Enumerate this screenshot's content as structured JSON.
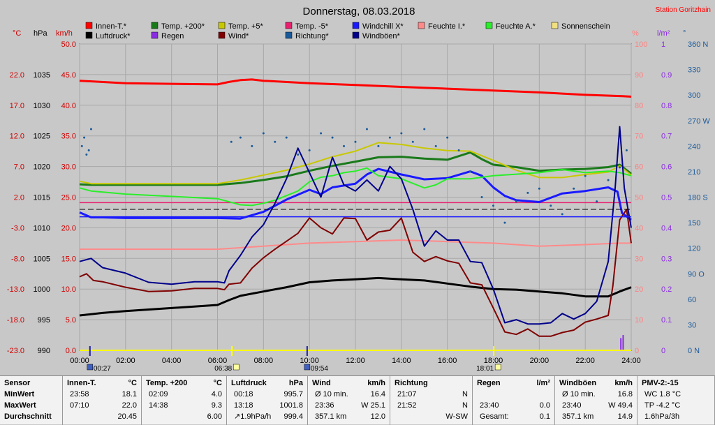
{
  "header": {
    "title": "Donnerstag, 08.03.2018",
    "station": "Station Goritzhain"
  },
  "colors": {
    "background": "#c8c8c8",
    "plot_area": "#c8c8c8",
    "grid": "#a8a8a8"
  },
  "legend": [
    {
      "label": "Innen-T.*",
      "color": "#ff0000"
    },
    {
      "label": "Temp. +200*",
      "color": "#1a7a1a"
    },
    {
      "label": "Temp. +5*",
      "color": "#c8c800"
    },
    {
      "label": "Temp. -5*",
      "color": "#e8206e"
    },
    {
      "label": "Windchill X*",
      "color": "#1a1aff"
    },
    {
      "label": "Feuchte I.*",
      "color": "#ff8a8a"
    },
    {
      "label": "Feuchte A.*",
      "color": "#2aee2a"
    },
    {
      "label": "Sonnenschein",
      "color": "#f0e080"
    },
    {
      "label": "Luftdruck*",
      "color": "#000000"
    },
    {
      "label": "Regen",
      "color": "#8a2be2"
    },
    {
      "label": "Wind*",
      "color": "#800000"
    },
    {
      "label": "Richtung*",
      "color": "#1a5a9a"
    },
    {
      "label": "Windböen*",
      "color": "#00008b"
    }
  ],
  "axes": {
    "left_units": [
      "°C",
      "hPa",
      "km/h"
    ],
    "right_units": [
      "%",
      "l/m²",
      "°"
    ],
    "celsius_ticks": [
      "22.0",
      "17.0",
      "12.0",
      "7.0",
      "2.0",
      "-3.0",
      "-8.0",
      "-13.0",
      "-18.0",
      "-23.0"
    ],
    "hpa_ticks": [
      "1035",
      "1030",
      "1025",
      "1020",
      "1015",
      "1010",
      "1005",
      "1000",
      "995",
      "990"
    ],
    "kmh_ticks": [
      "50.0",
      "45.0",
      "40.0",
      "35.0",
      "30.0",
      "25.0",
      "20.0",
      "15.0",
      "10.0",
      "5.0",
      "0.0"
    ],
    "pct_ticks": [
      "100",
      "90",
      "80",
      "70",
      "60",
      "50",
      "40",
      "30",
      "20",
      "10",
      "0"
    ],
    "rain_ticks": [
      "1",
      "0.9",
      "0.8",
      "0.7",
      "0.6",
      "0.5",
      "0.4",
      "0.3",
      "0.2",
      "0.1",
      "0"
    ],
    "dir_ticks": [
      "360 N",
      "330",
      "300",
      "270 W",
      "240",
      "210",
      "180 S",
      "150",
      "120",
      "90 O",
      "60",
      "30",
      "0  N"
    ],
    "time_ticks": [
      "00:00",
      "02:00",
      "04:00",
      "06:00",
      "08:00",
      "10:00",
      "12:00",
      "14:00",
      "16:00",
      "18:00",
      "20:00",
      "22:00",
      "24:00"
    ],
    "sun_events": [
      {
        "label": "00:27",
        "type": "moonrise"
      },
      {
        "label": "06:38",
        "type": "sunrise"
      },
      {
        "label": "09:54",
        "type": "moonset"
      },
      {
        "label": "18:01",
        "type": "sunset"
      }
    ]
  },
  "chart_data": {
    "type": "line",
    "x_unit": "hour",
    "x_range": [
      0,
      24
    ],
    "y_ranges": {
      "temp_c": [
        -23,
        27
      ],
      "pressure_hpa": [
        990,
        1040
      ],
      "wind_kmh": [
        0,
        50
      ],
      "humidity_pct": [
        0,
        100
      ],
      "rain_lm2": [
        0,
        1
      ],
      "direction_deg": [
        0,
        360
      ]
    },
    "grid": true,
    "series": [
      {
        "name": "Innen-T.*",
        "axis": "temp_c",
        "x": [
          0,
          2,
          4,
          6,
          6.5,
          7,
          7.5,
          8,
          10,
          12,
          14,
          16,
          18,
          20,
          22,
          23.5,
          24
        ],
        "y": [
          21.0,
          20.6,
          20.5,
          20.4,
          20.8,
          21.1,
          21.2,
          21.0,
          20.6,
          20.3,
          20.0,
          19.7,
          19.4,
          19.1,
          18.7,
          18.5,
          18.4
        ]
      },
      {
        "name": "Temp. +200*",
        "axis": "temp_c",
        "x": [
          0,
          0.5,
          2,
          4,
          6,
          7,
          8,
          9,
          10,
          11,
          12,
          13,
          14,
          15,
          16,
          17,
          17.5,
          18,
          19,
          20,
          21,
          22,
          23,
          23.5,
          24
        ],
        "y": [
          4.1,
          4.0,
          4.0,
          4.0,
          4.0,
          4.3,
          4.8,
          5.4,
          6.3,
          7.1,
          7.8,
          8.5,
          8.6,
          8.3,
          8.1,
          9.3,
          8.2,
          7.3,
          6.9,
          6.3,
          6.5,
          6.6,
          6.9,
          7.3,
          5.8
        ]
      },
      {
        "name": "Temp. +5*",
        "axis": "temp_c",
        "x": [
          0,
          0.5,
          2,
          4,
          6,
          7,
          8,
          9,
          10,
          11,
          12,
          13,
          14,
          15,
          16,
          17,
          18,
          19,
          20,
          21,
          22,
          23,
          23.5,
          24
        ],
        "y": [
          4.6,
          4.2,
          4.2,
          4.2,
          4.2,
          4.8,
          5.6,
          6.4,
          7.4,
          8.6,
          9.5,
          10.9,
          10.6,
          10.0,
          9.6,
          9.5,
          8.0,
          6.4,
          5.2,
          5.2,
          5.7,
          6.1,
          7.1,
          5.6
        ]
      },
      {
        "name": "Temp. -5*",
        "axis": "temp_c",
        "x": [
          0,
          4,
          8,
          12,
          16,
          20,
          24
        ],
        "y": [
          1.1,
          1.1,
          1.1,
          1.1,
          1.1,
          1.1,
          1.1
        ]
      },
      {
        "name": "Windchill X*",
        "axis": "temp_c",
        "x": [
          0,
          0.5,
          1,
          2,
          4,
          6,
          7,
          8,
          9,
          10,
          10.5,
          11,
          12,
          12.5,
          13,
          14,
          15,
          16,
          17,
          17.5,
          18,
          18.5,
          19,
          20,
          21,
          22,
          23,
          23.4,
          23.6,
          24
        ],
        "y": [
          -0.5,
          -1.3,
          -1.3,
          -1.4,
          -1.4,
          -1.4,
          -1.5,
          -0.4,
          1.6,
          3.2,
          2.5,
          3.6,
          4.2,
          5.7,
          6.6,
          5.7,
          4.9,
          5.1,
          6.2,
          5.5,
          3.6,
          2.2,
          1.5,
          1.2,
          2.6,
          3.0,
          3.6,
          2.9,
          -0.6,
          -1.7
        ]
      },
      {
        "name": "Feuchte I.*",
        "axis": "humidity_pct",
        "x": [
          0,
          2,
          4,
          6,
          8,
          10,
          12,
          14,
          16,
          18,
          20,
          22,
          23.5,
          24
        ],
        "y": [
          33,
          33,
          33,
          33,
          34,
          35,
          35.5,
          36,
          35.5,
          35,
          34,
          34.5,
          35,
          35
        ]
      },
      {
        "name": "Feuchte A.*",
        "axis": "humidity_pct",
        "x": [
          0,
          0.5,
          2,
          6,
          7,
          7.5,
          8,
          8.5,
          9,
          9.5,
          10,
          10.5,
          11,
          11.5,
          12,
          12.5,
          13,
          14,
          15,
          15.5,
          16,
          17,
          18,
          19,
          20,
          21,
          22,
          23,
          23.5,
          24
        ],
        "y": [
          53,
          52,
          51,
          49.5,
          47.5,
          47.3,
          48,
          49,
          50.5,
          52,
          55,
          56.5,
          57,
          58,
          58.5,
          59.5,
          57,
          56,
          53,
          54,
          56,
          56,
          57,
          57.5,
          58,
          59,
          58,
          58.5,
          58,
          57
        ]
      },
      {
        "name": "Luftdruck*",
        "axis": "pressure_hpa",
        "x": [
          0,
          1,
          2,
          4,
          6,
          6.5,
          7,
          8,
          9,
          10,
          11,
          12,
          13,
          14,
          15,
          16,
          17,
          18,
          19,
          20,
          21,
          22,
          23,
          23.5,
          24
        ],
        "y": [
          995.7,
          996.1,
          996.4,
          996.9,
          997.4,
          998.2,
          998.9,
          999.6,
          1000.3,
          1001.1,
          1001.4,
          1001.6,
          1001.8,
          1001.6,
          1001.4,
          1000.9,
          1000.4,
          1000.0,
          999.9,
          999.6,
          999.3,
          998.8,
          998.8,
          999.6,
          1000.3
        ]
      },
      {
        "name": "Wind*",
        "axis": "wind_kmh",
        "x": [
          0,
          0.3,
          0.6,
          1,
          2,
          3,
          4,
          5,
          6,
          6.3,
          6.5,
          7,
          7.5,
          8,
          8.5,
          9,
          9.5,
          10,
          10.5,
          11,
          11.5,
          12,
          12.5,
          13,
          13.5,
          14,
          14.5,
          15,
          15.5,
          16,
          16.5,
          17,
          17.5,
          18,
          18.5,
          19,
          19.5,
          20,
          20.5,
          21,
          21.5,
          22,
          22.5,
          23,
          23.2,
          23.5,
          23.8,
          24
        ],
        "y": [
          12,
          12.5,
          11.4,
          11.2,
          10.3,
          9.6,
          9.7,
          10.1,
          10.1,
          9.9,
          10.8,
          11,
          13.4,
          15.1,
          16.5,
          17.8,
          19.1,
          21.6,
          20,
          19,
          21.6,
          21.5,
          18,
          19.3,
          19.6,
          21.6,
          16,
          14.5,
          15.3,
          14.6,
          14.2,
          11,
          10.7,
          6.9,
          3,
          2.6,
          3.5,
          2.3,
          2.3,
          2.9,
          3.3,
          4.6,
          5.1,
          5.7,
          10.5,
          21.3,
          23,
          17.5
        ]
      },
      {
        "name": "Windböen*",
        "axis": "wind_kmh",
        "x": [
          0,
          0.5,
          1,
          2,
          3,
          4,
          5,
          6,
          6.3,
          6.5,
          7,
          7.5,
          8,
          8.5,
          9,
          9.5,
          10,
          10.5,
          11,
          11.5,
          12,
          12.5,
          13,
          13.5,
          14,
          14.5,
          15,
          15.5,
          16,
          16.5,
          17,
          17.5,
          18,
          18.5,
          19,
          19.5,
          20,
          20.5,
          21,
          21.5,
          22,
          22.5,
          23,
          23.3,
          23.5,
          23.7,
          24
        ],
        "y": [
          14.5,
          15,
          13.5,
          12.6,
          11.1,
          10.8,
          11.2,
          11.2,
          11,
          13,
          15.5,
          18.5,
          20.5,
          24,
          28,
          33,
          29,
          25,
          31.5,
          27,
          26,
          27.8,
          26,
          30,
          28,
          23,
          17,
          19.5,
          18,
          18,
          14.5,
          14.3,
          10,
          4.5,
          5,
          4.3,
          4.3,
          4.5,
          6,
          5.1,
          6,
          8,
          14.5,
          26.5,
          36.5,
          26.5,
          20
        ]
      },
      {
        "name": "Richtung*",
        "axis": "direction_deg",
        "x": [
          0.1,
          0.2,
          0.3,
          0.4,
          0.5,
          6.6,
          7,
          7.5,
          8,
          8.5,
          9,
          9.5,
          10,
          10.5,
          11,
          11.5,
          12,
          12.5,
          13,
          13.5,
          14,
          14.5,
          15,
          15.5,
          16,
          16.5,
          17,
          17.5,
          18,
          18.5,
          19,
          19.5,
          20,
          20.5,
          21,
          21.5,
          22,
          22.5,
          23,
          23.5,
          23.8
        ],
        "y": [
          240,
          250,
          230,
          235,
          260,
          245,
          250,
          240,
          255,
          245,
          250,
          230,
          235,
          255,
          250,
          240,
          245,
          260,
          240,
          250,
          255,
          245,
          260,
          240,
          250,
          235,
          210,
          180,
          170,
          150,
          175,
          185,
          190,
          170,
          160,
          190,
          205,
          175,
          200,
          215,
          235
        ]
      },
      {
        "name": "Regen",
        "axis": "rain_lm2",
        "x": [
          23.55,
          23.65
        ],
        "y": [
          0.04,
          0.05
        ]
      }
    ]
  },
  "stats": {
    "columns": [
      {
        "head": "Sensor",
        "unit": "",
        "rows": [
          [
            "MinWert",
            "",
            ""
          ],
          [
            "MaxWert",
            "",
            ""
          ],
          [
            "Durchschnitt",
            "",
            ""
          ]
        ]
      },
      {
        "head": "Innen-T.",
        "unit": "°C",
        "rows": [
          [
            "23:58",
            "",
            "18.1"
          ],
          [
            "07:10",
            "",
            "22.0"
          ],
          [
            "",
            "",
            "20.45"
          ]
        ]
      },
      {
        "head": "Temp. +200",
        "unit": "°C",
        "rows": [
          [
            "02:09",
            "",
            "4.0"
          ],
          [
            "14:38",
            "",
            "9.3"
          ],
          [
            "",
            "",
            "6.00"
          ]
        ]
      },
      {
        "head": "Luftdruck",
        "unit": "hPa",
        "rows": [
          [
            "00:18",
            "",
            "995.7"
          ],
          [
            "13:18",
            "",
            "1001.8"
          ],
          [
            "↗1.9hPa/h",
            "",
            "999.4"
          ]
        ]
      },
      {
        "head": "Wind",
        "unit": "km/h",
        "rows": [
          [
            "Ø 10 min.",
            "",
            "16.4"
          ],
          [
            "23:36",
            "",
            "W 25.1"
          ],
          [
            "357.1 km",
            "",
            "12.0"
          ]
        ]
      },
      {
        "head": "Richtung",
        "unit": "",
        "rows": [
          [
            "21:07",
            "",
            "N"
          ],
          [
            "21:52",
            "",
            "N"
          ],
          [
            "",
            "",
            "W-SW"
          ]
        ]
      },
      {
        "head": "Regen",
        "unit": "l/m²",
        "rows": [
          [
            "",
            "",
            ""
          ],
          [
            "23:40",
            "",
            "0.0"
          ],
          [
            "Gesamt:",
            "",
            "0.1"
          ]
        ]
      },
      {
        "head": "Windböen",
        "unit": "km/h",
        "rows": [
          [
            "Ø 10 min.",
            "",
            "16.8"
          ],
          [
            "23:40",
            "",
            "W 49.4"
          ],
          [
            "357.1 km",
            "",
            "14.9"
          ]
        ]
      },
      {
        "head": "PMV-2:-15",
        "unit": "",
        "rows": [
          [
            "WC 1.8 °C",
            "",
            ""
          ],
          [
            "TP -4.2 °C",
            "",
            ""
          ],
          [
            "1.6hPa/3h",
            "",
            ""
          ]
        ]
      }
    ]
  }
}
